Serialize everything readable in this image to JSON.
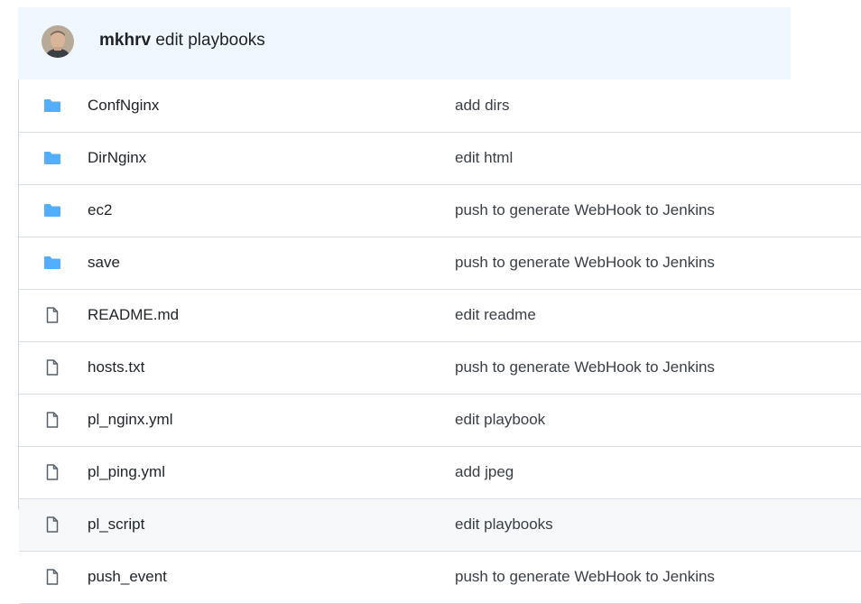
{
  "commit": {
    "author": "mkhrv",
    "message": "edit playbooks"
  },
  "colors": {
    "folder": "#54aeff",
    "file": "#57606a",
    "header_bg": "#f0f7fe",
    "row_hover": "#f6f8fa"
  },
  "files": [
    {
      "name": "ConfNginx",
      "type": "folder",
      "icon": "folder-icon",
      "message": "add dirs"
    },
    {
      "name": "DirNginx",
      "type": "folder",
      "icon": "folder-icon",
      "message": "edit html"
    },
    {
      "name": "ec2",
      "type": "folder",
      "icon": "folder-icon",
      "message": "push to generate WebHook to Jenkins"
    },
    {
      "name": "save",
      "type": "folder",
      "icon": "folder-icon",
      "message": "push to generate WebHook to Jenkins"
    },
    {
      "name": "README.md",
      "type": "file",
      "icon": "file-icon",
      "message": "edit readme"
    },
    {
      "name": "hosts.txt",
      "type": "file",
      "icon": "file-icon",
      "message": "push to generate WebHook to Jenkins"
    },
    {
      "name": "pl_nginx.yml",
      "type": "file",
      "icon": "file-icon",
      "message": "edit playbook"
    },
    {
      "name": "pl_ping.yml",
      "type": "file",
      "icon": "file-icon",
      "message": "add jpeg"
    },
    {
      "name": "pl_script",
      "type": "file",
      "icon": "file-icon",
      "message": "edit playbooks",
      "highlighted": true
    },
    {
      "name": "push_event",
      "type": "file",
      "icon": "file-icon",
      "message": "push to generate WebHook to Jenkins"
    }
  ]
}
